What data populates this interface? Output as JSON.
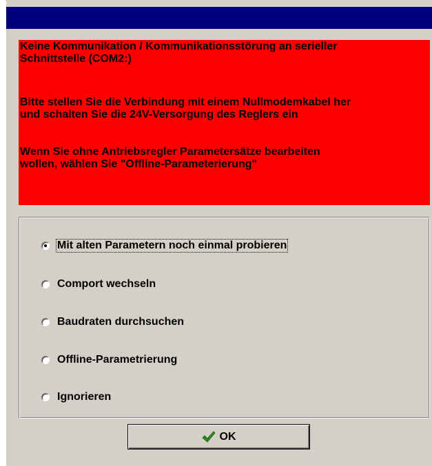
{
  "window": {
    "title": ""
  },
  "message": {
    "line_1": "Keine Kommunikation / Kommunikationsstörung an serieller",
    "line_2": "Schnittstelle (COM2:)",
    "line_3": "Bitte stellen Sie die Verbindung mit einem Nullmodemkabel her",
    "line_4": "und schalten Sie die 24V-Versorgung des Reglers ein",
    "line_5": "Wenn Sie ohne Antriebsregler Parametersätze bearbeiten",
    "line_6": "wollen, wählen Sie \"Offline-Parameterierung\""
  },
  "options": [
    {
      "label": "Mit alten Parametern noch einmal probieren",
      "selected": true
    },
    {
      "label": "Comport wechseln",
      "selected": false
    },
    {
      "label": "Baudraten durchsuchen",
      "selected": false
    },
    {
      "label": "Offline-Parametrierung",
      "selected": false
    },
    {
      "label": "Ignorieren",
      "selected": false
    }
  ],
  "ok_button": {
    "label": "OK",
    "icon": "checkmark-icon"
  },
  "colors": {
    "title_bar": "#00007f",
    "message_background": "#ff0000",
    "dialog_background": "#d4d0c8",
    "check_icon": "#2e8b1f"
  }
}
